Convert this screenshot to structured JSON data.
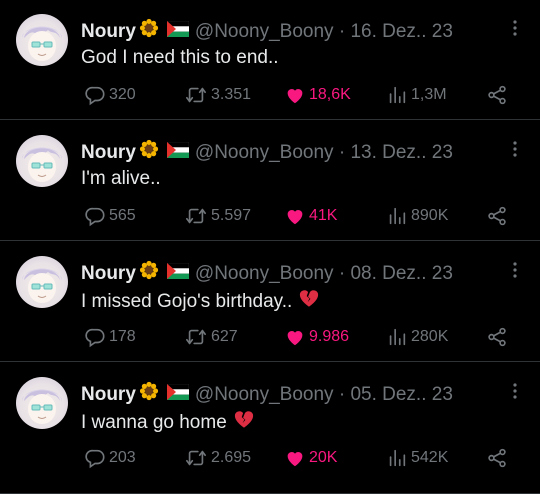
{
  "colors": {
    "like": "#f91880",
    "muted": "#71767b",
    "text": "#e7e9ea",
    "background": "#000000"
  },
  "tweets": [
    {
      "name": "Noury",
      "handle": "@Noony_Boony",
      "date": "16. Dez.. 23",
      "text": "God I need this to end..",
      "has_heart_emoji": false,
      "replies": "320",
      "retweets": "3.351",
      "likes": "18,6K",
      "views": "1,3M"
    },
    {
      "name": "Noury",
      "handle": "@Noony_Boony",
      "date": "13. Dez.. 23",
      "text": "I'm alive..",
      "has_heart_emoji": false,
      "replies": "565",
      "retweets": "5.597",
      "likes": "41K",
      "views": "890K"
    },
    {
      "name": "Noury",
      "handle": "@Noony_Boony",
      "date": "08. Dez.. 23",
      "text": "I missed Gojo's birthday..",
      "has_heart_emoji": true,
      "replies": "178",
      "retweets": "627",
      "likes": "9.986",
      "views": "280K"
    },
    {
      "name": "Noury",
      "handle": "@Noony_Boony",
      "date": "05. Dez.. 23",
      "text": "I wanna go home",
      "has_heart_emoji": true,
      "replies": "203",
      "retweets": "2.695",
      "likes": "20K",
      "views": "542K"
    }
  ],
  "icons": {
    "name_emoji": "sunflower-icon",
    "flag": "palestine-flag-icon",
    "text_emoji": "broken-heart-icon",
    "reply": "reply-icon",
    "retweet": "retweet-icon",
    "like": "heart-icon",
    "views": "views-icon",
    "share": "share-icon",
    "more": "more-options-icon"
  }
}
